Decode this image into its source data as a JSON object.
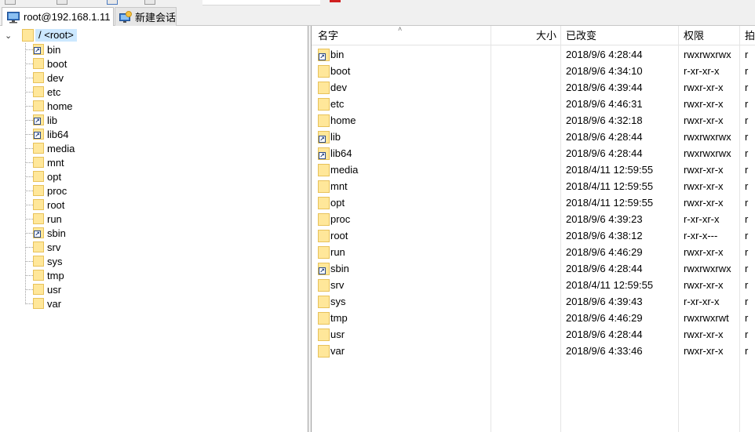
{
  "tabs": {
    "session_label": "root@192.168.1.11",
    "new_label": "新建会话"
  },
  "tree": {
    "root_label": "/ <root>",
    "items": [
      {
        "label": "bin",
        "link": true
      },
      {
        "label": "boot",
        "link": false
      },
      {
        "label": "dev",
        "link": false
      },
      {
        "label": "etc",
        "link": false
      },
      {
        "label": "home",
        "link": false
      },
      {
        "label": "lib",
        "link": true
      },
      {
        "label": "lib64",
        "link": true
      },
      {
        "label": "media",
        "link": false
      },
      {
        "label": "mnt",
        "link": false
      },
      {
        "label": "opt",
        "link": false
      },
      {
        "label": "proc",
        "link": false
      },
      {
        "label": "root",
        "link": false
      },
      {
        "label": "run",
        "link": false
      },
      {
        "label": "sbin",
        "link": true
      },
      {
        "label": "srv",
        "link": false
      },
      {
        "label": "sys",
        "link": false
      },
      {
        "label": "tmp",
        "link": false
      },
      {
        "label": "usr",
        "link": false
      },
      {
        "label": "var",
        "link": false
      }
    ]
  },
  "list": {
    "columns": {
      "name": "名字",
      "size": "大小",
      "modified": "已改变",
      "permissions": "权限",
      "owner_partial": "拍"
    },
    "rows": [
      {
        "name": "bin",
        "link": true,
        "modified": "2018/9/6 4:28:44",
        "perm": "rwxrwxrwx",
        "owner": "r"
      },
      {
        "name": "boot",
        "link": false,
        "modified": "2018/9/6 4:34:10",
        "perm": "r-xr-xr-x",
        "owner": "r"
      },
      {
        "name": "dev",
        "link": false,
        "modified": "2018/9/6 4:39:44",
        "perm": "rwxr-xr-x",
        "owner": "r"
      },
      {
        "name": "etc",
        "link": false,
        "modified": "2018/9/6 4:46:31",
        "perm": "rwxr-xr-x",
        "owner": "r"
      },
      {
        "name": "home",
        "link": false,
        "modified": "2018/9/6 4:32:18",
        "perm": "rwxr-xr-x",
        "owner": "r"
      },
      {
        "name": "lib",
        "link": true,
        "modified": "2018/9/6 4:28:44",
        "perm": "rwxrwxrwx",
        "owner": "r"
      },
      {
        "name": "lib64",
        "link": true,
        "modified": "2018/9/6 4:28:44",
        "perm": "rwxrwxrwx",
        "owner": "r"
      },
      {
        "name": "media",
        "link": false,
        "modified": "2018/4/11 12:59:55",
        "perm": "rwxr-xr-x",
        "owner": "r"
      },
      {
        "name": "mnt",
        "link": false,
        "modified": "2018/4/11 12:59:55",
        "perm": "rwxr-xr-x",
        "owner": "r"
      },
      {
        "name": "opt",
        "link": false,
        "modified": "2018/4/11 12:59:55",
        "perm": "rwxr-xr-x",
        "owner": "r"
      },
      {
        "name": "proc",
        "link": false,
        "modified": "2018/9/6 4:39:23",
        "perm": "r-xr-xr-x",
        "owner": "r"
      },
      {
        "name": "root",
        "link": false,
        "modified": "2018/9/6 4:38:12",
        "perm": "r-xr-x---",
        "owner": "r"
      },
      {
        "name": "run",
        "link": false,
        "modified": "2018/9/6 4:46:29",
        "perm": "rwxr-xr-x",
        "owner": "r"
      },
      {
        "name": "sbin",
        "link": true,
        "modified": "2018/9/6 4:28:44",
        "perm": "rwxrwxrwx",
        "owner": "r"
      },
      {
        "name": "srv",
        "link": false,
        "modified": "2018/4/11 12:59:55",
        "perm": "rwxr-xr-x",
        "owner": "r"
      },
      {
        "name": "sys",
        "link": false,
        "modified": "2018/9/6 4:39:43",
        "perm": "r-xr-xr-x",
        "owner": "r"
      },
      {
        "name": "tmp",
        "link": false,
        "modified": "2018/9/6 4:46:29",
        "perm": "rwxrwxrwt",
        "owner": "r"
      },
      {
        "name": "usr",
        "link": false,
        "modified": "2018/9/6 4:28:44",
        "perm": "rwxr-xr-x",
        "owner": "r"
      },
      {
        "name": "var",
        "link": false,
        "modified": "2018/9/6 4:33:46",
        "perm": "rwxr-xr-x",
        "owner": "r"
      }
    ]
  }
}
